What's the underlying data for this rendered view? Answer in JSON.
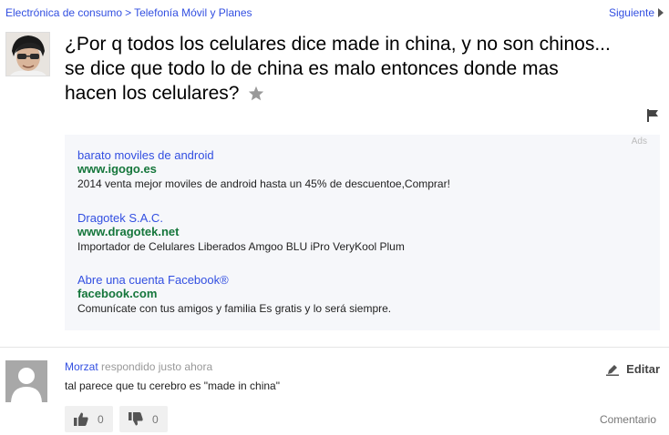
{
  "breadcrumb": {
    "category": "Electrónica de consumo",
    "separator": ">",
    "subcategory": "Telefonía Móvil y Planes"
  },
  "nav": {
    "next_label": "Siguiente"
  },
  "question": {
    "title": "¿Por q todos los celulares dice made in china, y no son chinos... se dice que todo lo de china es malo entonces donde mas hacen los celulares?"
  },
  "ads": {
    "label": "Ads",
    "items": [
      {
        "title": "barato moviles de android",
        "url": "www.igogo.es",
        "description": "2014 venta mejor moviles de android hasta un 45% de descuentoe,Comprar!"
      },
      {
        "title": "Dragotek S.A.C.",
        "url": "www.dragotek.net",
        "description": "Importador de Celulares Liberados Amgoo BLU iPro VeryKool Plum"
      },
      {
        "title": "Abre una cuenta Facebook®",
        "url": "facebook.com",
        "description": "Comunícate con tus amigos y familia Es gratis y lo será siempre."
      }
    ]
  },
  "answer": {
    "user": "Morzat",
    "meta": "respondido justo ahora",
    "text": "tal parece que tu cerebro es \"made in china\"",
    "edit_label": "Editar",
    "upvotes": "0",
    "downvotes": "0",
    "comment_label": "Comentario"
  },
  "colors": {
    "link": "#324fe1",
    "ad_url": "#15763b",
    "ad_background": "#f6f7fa"
  }
}
